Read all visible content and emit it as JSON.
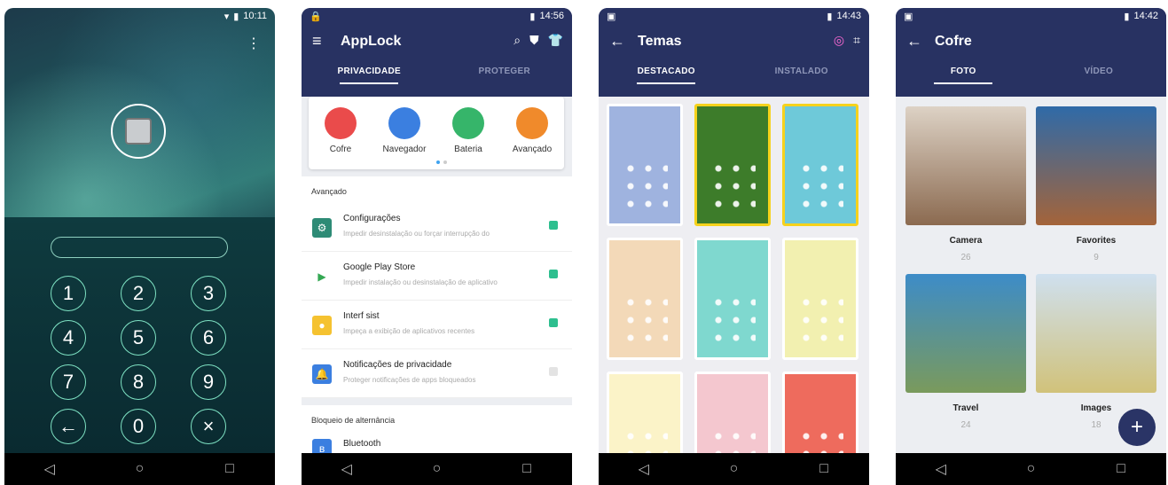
{
  "phone1": {
    "status_time": "10:11",
    "keys": [
      "1",
      "2",
      "3",
      "4",
      "5",
      "6",
      "7",
      "8",
      "9",
      "←",
      "0",
      "×"
    ]
  },
  "phone2": {
    "status_time": "14:56",
    "title": "AppLock",
    "tabs": [
      "PRIVACIDADE",
      "PROTEGER"
    ],
    "quick": [
      {
        "label": "Cofre",
        "color": "#ea4b4b"
      },
      {
        "label": "Navegador",
        "color": "#3b7fe0"
      },
      {
        "label": "Bateria",
        "color": "#36b56a"
      },
      {
        "label": "Avançado",
        "color": "#f08a2b"
      }
    ],
    "section1": "Avançado",
    "rows": [
      {
        "title": "Configurações",
        "sub": "Impedir desinstalação ou forçar interrupção do",
        "color": "#2e8b76",
        "icon": "⚙",
        "locked": true
      },
      {
        "title": "Google Play Store",
        "sub": "Impedir instalação ou desinstalação de aplicativo",
        "color": "#ffffff",
        "icon": "▶",
        "locked": true
      },
      {
        "title": "Interf sist",
        "sub": "Impeça a exibição de aplicativos recentes",
        "color": "#f5c230",
        "icon": "●",
        "locked": true
      },
      {
        "title": "Notificações de privacidade",
        "sub": "Proteger notificações de apps bloqueados",
        "color": "#3b7fe0",
        "icon": "🔔",
        "locked": false
      }
    ],
    "section2": "Bloqueio de alternância",
    "row_bt": "Bluetooth"
  },
  "phone3": {
    "status_time": "14:43",
    "title": "Temas",
    "tabs": [
      "DESTACADO",
      "INSTALADO"
    ],
    "themes": [
      {
        "bg": "#9fb3df",
        "sel": false
      },
      {
        "bg": "#3d7c2a",
        "sel": true
      },
      {
        "bg": "#6ec9d9",
        "sel": true
      },
      {
        "bg": "#f3d9b8",
        "sel": false
      },
      {
        "bg": "#7fd8cf",
        "sel": false
      },
      {
        "bg": "#f2f0b0",
        "sel": false
      },
      {
        "bg": "#fbf3c8",
        "sel": false
      },
      {
        "bg": "#f4c7cf",
        "sel": false
      },
      {
        "bg": "#ee6b5d",
        "sel": false
      }
    ]
  },
  "phone4": {
    "status_time": "14:42",
    "title": "Cofre",
    "tabs": [
      "FOTO",
      "VÍDEO"
    ],
    "albums": [
      {
        "name": "Camera",
        "count": "26",
        "c1": "#ddd2c5",
        "c2": "#8b6a50"
      },
      {
        "name": "Favorites",
        "count": "9",
        "c1": "#2f6aa8",
        "c2": "#a4643a"
      },
      {
        "name": "Travel",
        "count": "24",
        "c1": "#3d8cc8",
        "c2": "#7a9a5c"
      },
      {
        "name": "Images",
        "count": "18",
        "c1": "#cfe0ef",
        "c2": "#d1c27a"
      }
    ],
    "fab": "+"
  },
  "nav": [
    "◁",
    "○",
    "□"
  ]
}
